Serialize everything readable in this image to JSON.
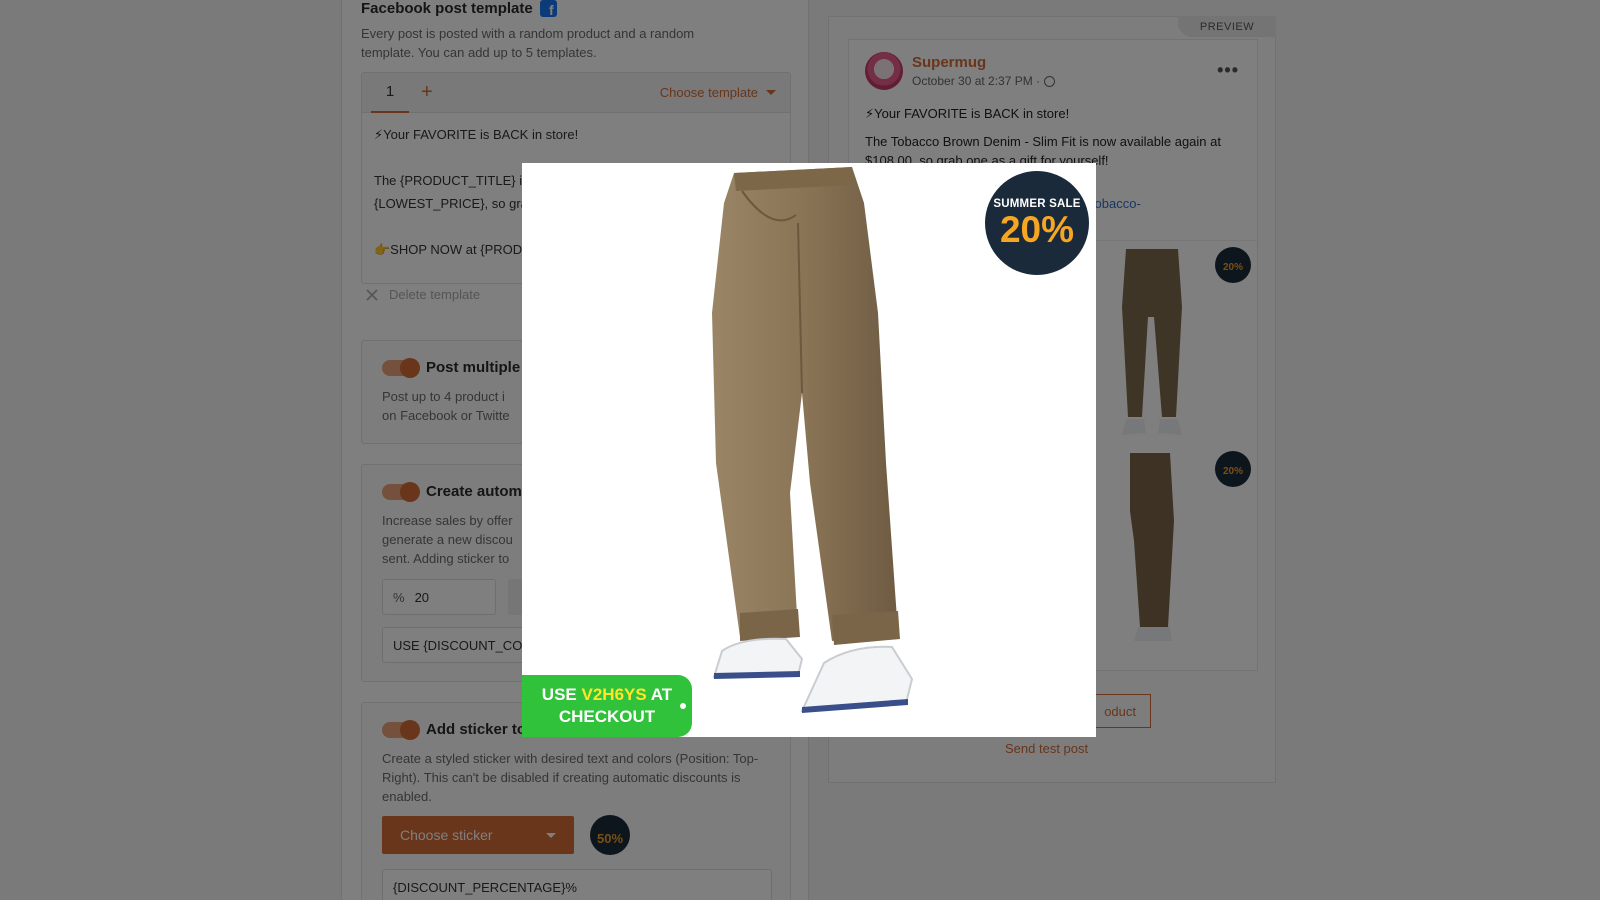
{
  "facebook_template": {
    "title": "Facebook post template",
    "description": "Every post is posted with a random product and a random template. You can add up to 5 templates.",
    "active_tab": "1",
    "add_tab": "+",
    "choose_template": "Choose template",
    "text_lines": [
      "⚡Your FAVORITE is BACK in store!",
      "",
      "The {PRODUCT_TITLE} i",
      "{LOWEST_PRICE}, so gra",
      "",
      "👉SHOP NOW at {PROD"
    ],
    "delete_label": "Delete template"
  },
  "post_multiple": {
    "title": "Post multiple",
    "description": "Post up to 4 product i\non Facebook or Twitte",
    "enabled": true
  },
  "auto_discount": {
    "title": "Create autom",
    "description": "Increase sales by offer\ngenerate a new discou\nsent. Adding sticker to",
    "pct_symbol": "%",
    "pct_value": "20",
    "code_value": "USE {DISCOUNT_CO",
    "enabled": true
  },
  "sticker": {
    "title": "Add sticker to image",
    "description": "Create a styled sticker with desired text and colors (Position: Top-Right). This can't be disabled if creating automatic discounts is enabled.",
    "choose_label": "Choose sticker",
    "badge_value": "50%",
    "text_value": "{DISCOUNT_PERCENTAGE}%",
    "enabled": true
  },
  "preview": {
    "tab_label": "PREVIEW",
    "page_name": "Supermug",
    "date": "October 30 at 2:37 PM ·",
    "more": "•••",
    "line1": "⚡Your FAVORITE is BACK in store!",
    "line2": "The Tobacco Brown Denim - Slim Fit is now available again at $108.00, so grab one as a gift for yourself!",
    "link": "oducts/tobacco-",
    "grid_sticker": "20%",
    "view_button": "oduct",
    "send_test": "Send test post"
  },
  "modal": {
    "sale_label": "SUMMER SALE",
    "sale_pct": "20%",
    "checkout_use": "USE",
    "checkout_code": "V2H6YS",
    "checkout_at": "AT",
    "checkout_word": "CHECKOUT"
  },
  "colors": {
    "accent": "#d26a37",
    "badge_bg": "#1b2a3b",
    "badge_pct": "#f5a623",
    "sticker_green": "#30c23a",
    "sticker_code": "#ffe629"
  }
}
